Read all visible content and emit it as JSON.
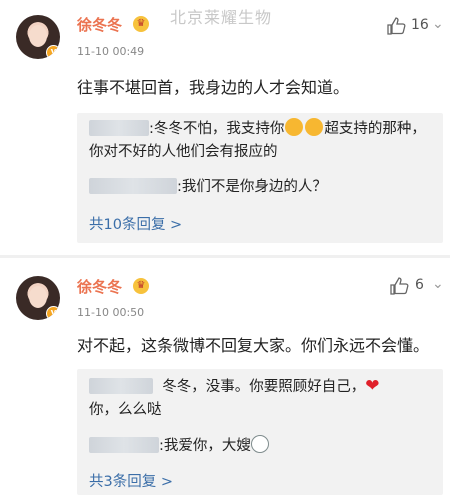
{
  "watermark": "北京莱耀生物",
  "comments": [
    {
      "username": "徐冬冬",
      "time": "11-10 00:49",
      "likes": "16",
      "text": "往事不堪回首，我身边的人才会知道。",
      "replies": [
        {
          "pre": ":冬冬不怕，我支持你",
          "post": "超支持的那种，你对不好的人他们会有报应的"
        },
        {
          "pre": ":我们不是你身边的人？"
        }
      ],
      "more_replies": "共10条回复 >"
    },
    {
      "username": "徐冬冬",
      "time": "11-10 00:50",
      "likes": "6",
      "text": "对不起，这条微博不回复大家。你们永远不会懂。",
      "replies": [
        {
          "pre": "冬冬，没事。你要照顾好自己，",
          "post": "你，么么哒"
        },
        {
          "pre": ":我爱你，大嫂"
        }
      ],
      "more_replies": "共3条回复 >"
    }
  ],
  "icons": {
    "crown": "crown-icon",
    "like": "thumbs-up-icon",
    "more": "chevron-down-icon",
    "verified": "verified-badge-icon"
  }
}
